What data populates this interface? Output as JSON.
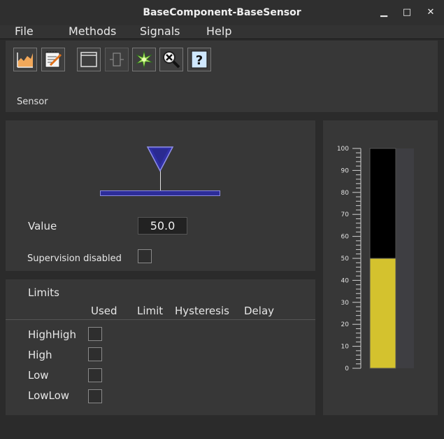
{
  "window": {
    "title": "BaseComponent-BaseSensor",
    "controls": {
      "minimize": "▁",
      "maximize": "□",
      "close": "✕"
    }
  },
  "menu": [
    "File",
    "Methods",
    "Signals",
    "Help"
  ],
  "toolbar": {
    "icons": [
      "trend-icon",
      "edit-notes-icon",
      "window-icon",
      "component-icon",
      "spark-icon",
      "object-search-icon",
      "help-icon"
    ],
    "help_glyph": "?",
    "label": "Sensor"
  },
  "value_panel": {
    "value_label": "Value",
    "value": "50.0",
    "supervision_label": "Supervision disabled",
    "slider_fraction": 0.5
  },
  "limits": {
    "title": "Limits",
    "columns": [
      "Used",
      "Limit",
      "Hysteresis",
      "Delay"
    ],
    "rows": [
      "HighHigh",
      "High",
      "Low",
      "LowLow"
    ]
  },
  "gauge": {
    "min": 0,
    "max": 100,
    "value": 50,
    "tick_labels": [
      "100",
      "90",
      "80",
      "70",
      "60",
      "50",
      "40",
      "30",
      "20",
      "10",
      "0"
    ],
    "fill_color": "#d4c22e",
    "empty_color": "#000000"
  }
}
